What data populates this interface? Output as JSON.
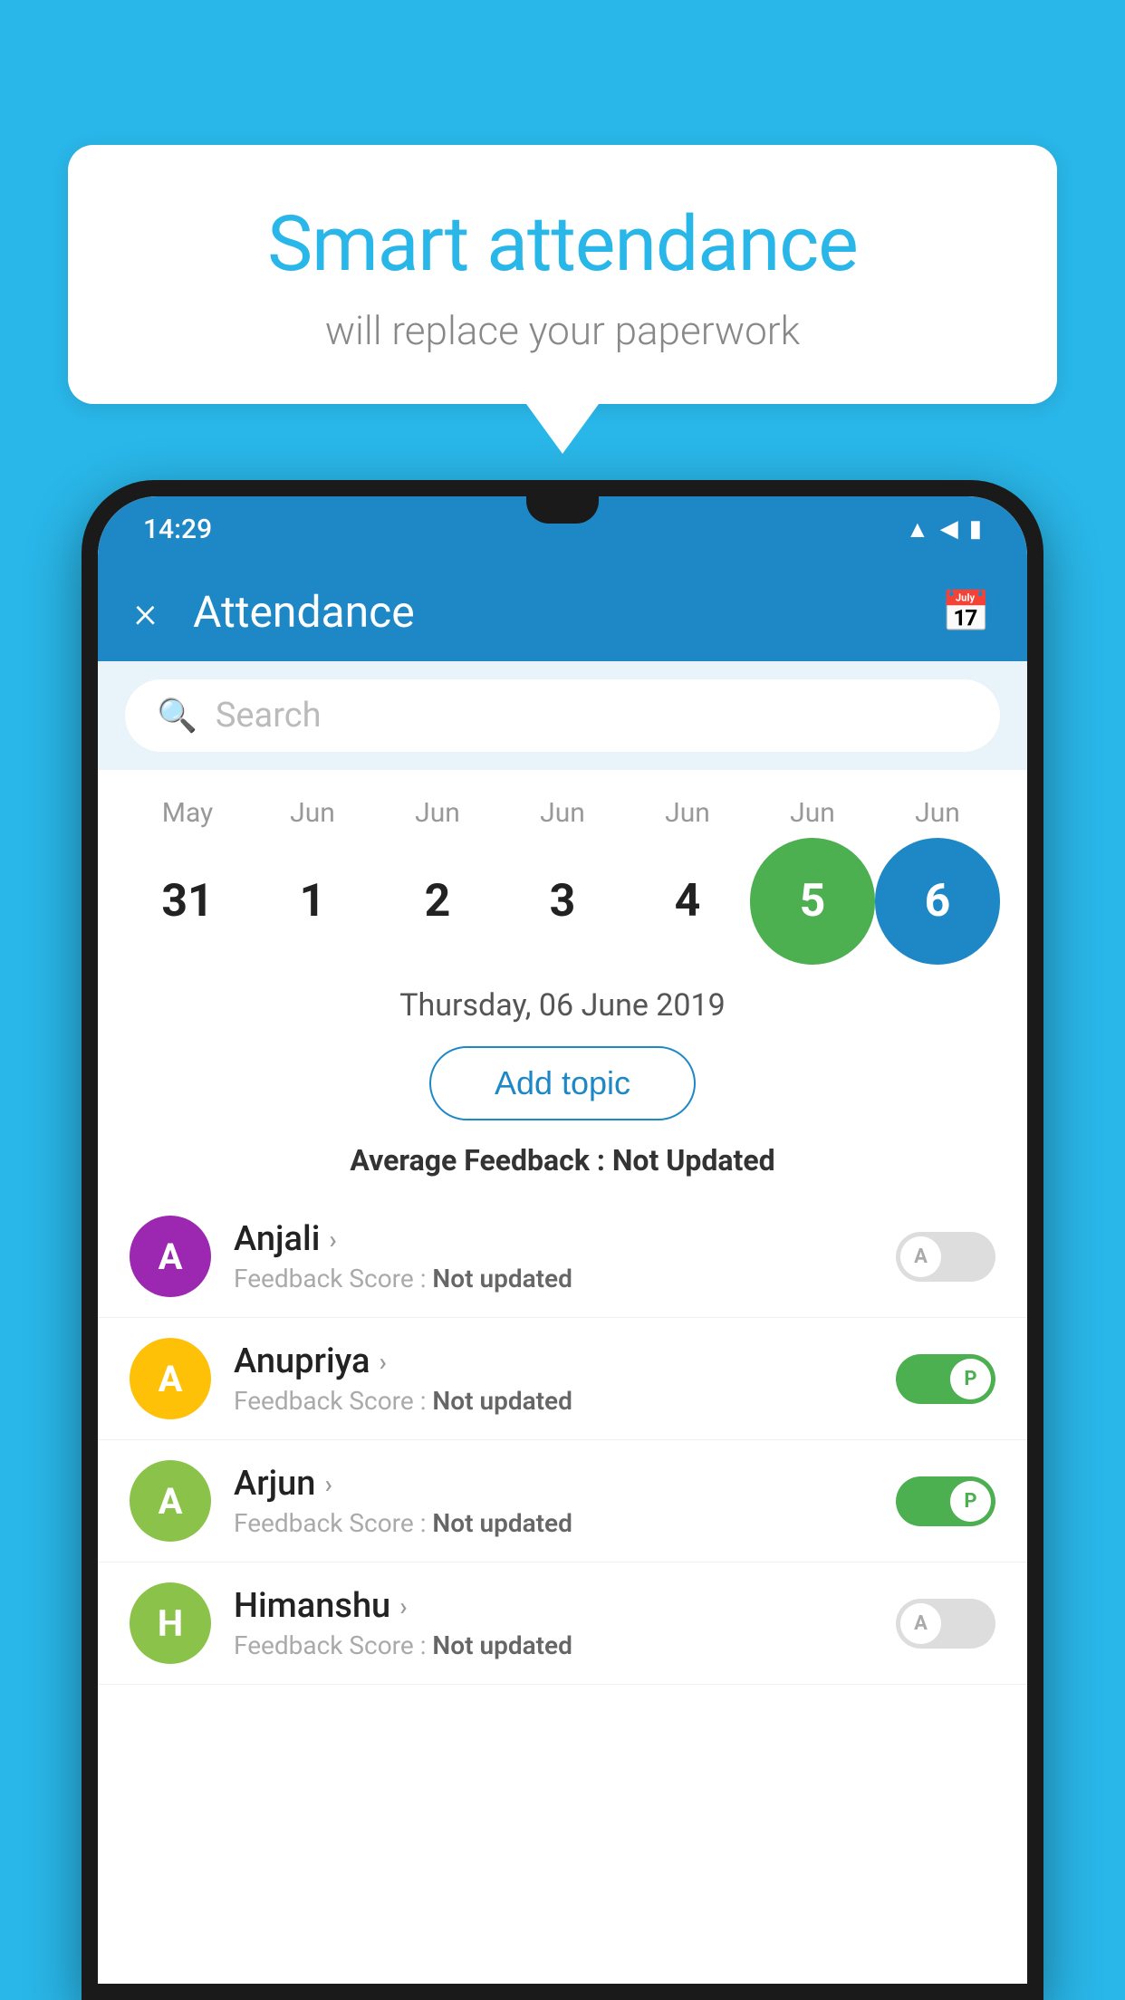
{
  "background_color": "#29b6e8",
  "hero": {
    "title": "Smart attendance",
    "subtitle": "will replace your paperwork"
  },
  "status_bar": {
    "time": "14:29",
    "wifi": "▼",
    "signal": "▲",
    "battery": "▮"
  },
  "app_bar": {
    "title": "Attendance",
    "close_label": "×",
    "calendar_icon": "calendar-icon"
  },
  "search": {
    "placeholder": "Search"
  },
  "calendar": {
    "months": [
      "May",
      "Jun",
      "Jun",
      "Jun",
      "Jun",
      "Jun",
      "Jun"
    ],
    "days": [
      "31",
      "1",
      "2",
      "3",
      "4",
      "5",
      "6"
    ],
    "states": [
      "normal",
      "normal",
      "normal",
      "normal",
      "normal",
      "today",
      "selected"
    ]
  },
  "selected_date": "Thursday, 06 June 2019",
  "add_topic_label": "Add topic",
  "avg_feedback_label": "Average Feedback : ",
  "avg_feedback_value": "Not Updated",
  "students": [
    {
      "name": "Anjali",
      "initial": "A",
      "avatar_color": "#9c27b0",
      "feedback_label": "Feedback Score : ",
      "feedback_value": "Not updated",
      "toggle": "off",
      "toggle_label": "A"
    },
    {
      "name": "Anupriya",
      "initial": "A",
      "avatar_color": "#ffc107",
      "feedback_label": "Feedback Score : ",
      "feedback_value": "Not updated",
      "toggle": "on",
      "toggle_label": "P"
    },
    {
      "name": "Arjun",
      "initial": "A",
      "avatar_color": "#8bc34a",
      "feedback_label": "Feedback Score : ",
      "feedback_value": "Not updated",
      "toggle": "on",
      "toggle_label": "P"
    },
    {
      "name": "Himanshu",
      "initial": "H",
      "avatar_color": "#8bc34a",
      "feedback_label": "Feedback Score : ",
      "feedback_value": "Not updated",
      "toggle": "off",
      "toggle_label": "A"
    }
  ]
}
